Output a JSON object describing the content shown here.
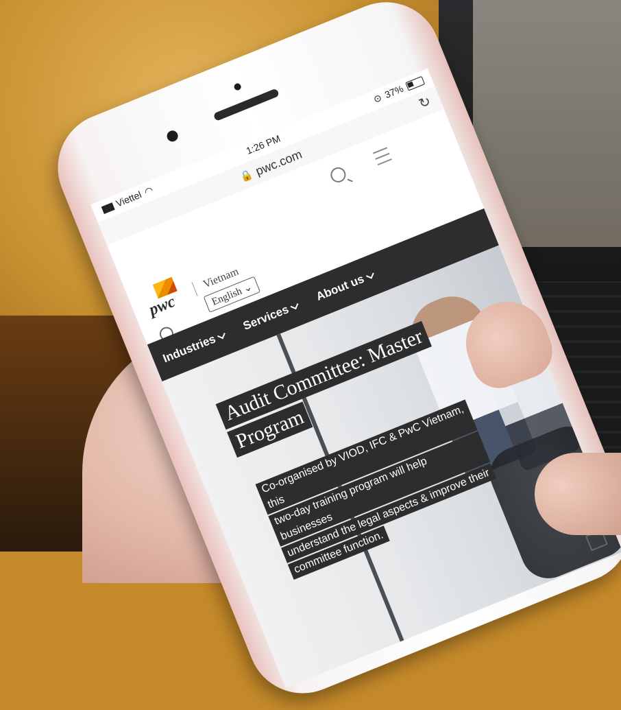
{
  "status_bar": {
    "carrier": "Viettel",
    "time": "1:26 PM",
    "battery": "37%"
  },
  "browser": {
    "url": "pwc.com"
  },
  "site": {
    "brand": "pwc",
    "country": "Vietnam",
    "language": "English",
    "nav": [
      {
        "label": "Industries"
      },
      {
        "label": "Services"
      },
      {
        "label": "About us"
      }
    ],
    "hero": {
      "title_lines": [
        "Audit Committee: Master",
        "Program"
      ],
      "body_lines": [
        "Co-organised by VIOD, IFC & PwC Vietnam, this",
        "two-day training program will help businesses",
        "understand the legal aspects & improve their",
        "committee function."
      ]
    }
  }
}
